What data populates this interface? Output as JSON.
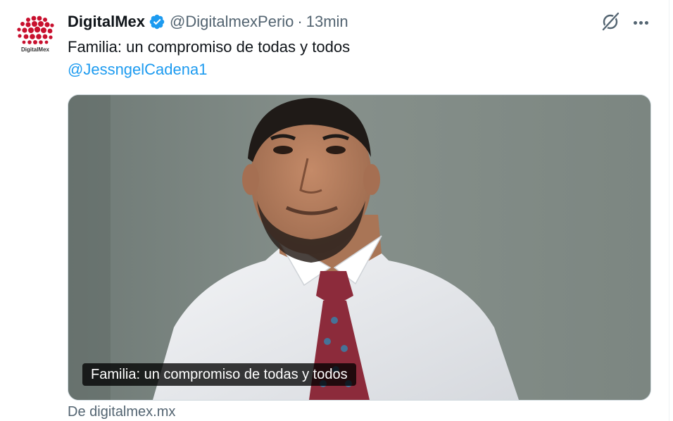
{
  "tweet": {
    "author_name": "DigitalMex",
    "author_handle": "@DigitalmexPerio",
    "separator": "·",
    "time": "13min",
    "text": "Familia: un compromiso de todas y todos",
    "mention": "@JessngelCadena1",
    "avatar_logo_text": "DigitalMex",
    "verified": true
  },
  "card": {
    "caption": "Familia: un compromiso de todas y todos",
    "source": "De digitalmex.mx",
    "image_description_icon": "portrait-photo"
  },
  "colors": {
    "link": "#1d9bf0",
    "secondary_text": "#536471",
    "verified_badge": "#1d9bf0",
    "logo_red": "#c8102e"
  },
  "icons": {
    "verified": "verified-badge-icon",
    "grok": "grok-icon",
    "more": "more-options-icon"
  }
}
